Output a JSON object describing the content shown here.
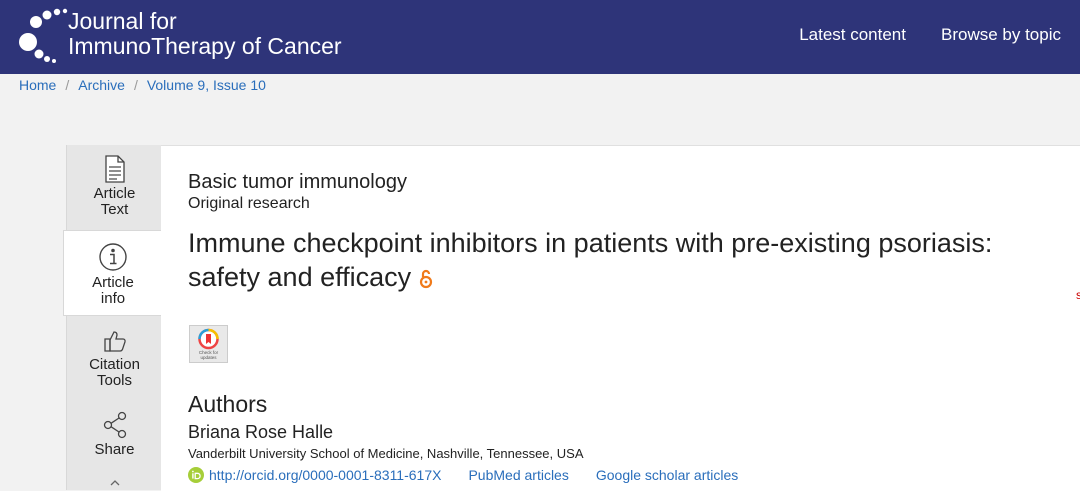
{
  "header": {
    "brand_line1": "Journal for",
    "brand_line2": "ImmunoTherapy of Cancer",
    "nav": [
      {
        "label": "Latest content"
      },
      {
        "label": "Browse by topic"
      }
    ]
  },
  "breadcrumb": [
    "Home",
    "Archive",
    "Volume 9, Issue 10"
  ],
  "rail": [
    {
      "label": "Article Text"
    },
    {
      "label": "Article info"
    },
    {
      "label": "Citation Tools"
    },
    {
      "label": "Share"
    }
  ],
  "article": {
    "subject": "Basic tumor immunology",
    "type": "Original research",
    "title": "Immune checkpoint inhibitors in patients with pre-existing psoriasis: safety and efficacy",
    "check_updates": "Check for updates",
    "authors_heading": "Authors",
    "author_name": "Briana Rose Halle",
    "affiliation": "Vanderbilt University School of Medicine, Nashville, Tennessee, USA",
    "orcid_link": "http://orcid.org/0000-0001-8311-617X",
    "pubmed_link": "PubMed articles",
    "scholar_link": "Google scholar articles",
    "edge_text": "s"
  },
  "colors": {
    "header_bg": "#2e3479",
    "link": "#2a6ebb",
    "open_access": "#f07a1a",
    "orcid": "#a6ce39"
  },
  "icons": [
    "article-text-icon",
    "info-icon",
    "thumbs-up-icon",
    "share-icon",
    "open-access-icon",
    "orcid-icon"
  ]
}
